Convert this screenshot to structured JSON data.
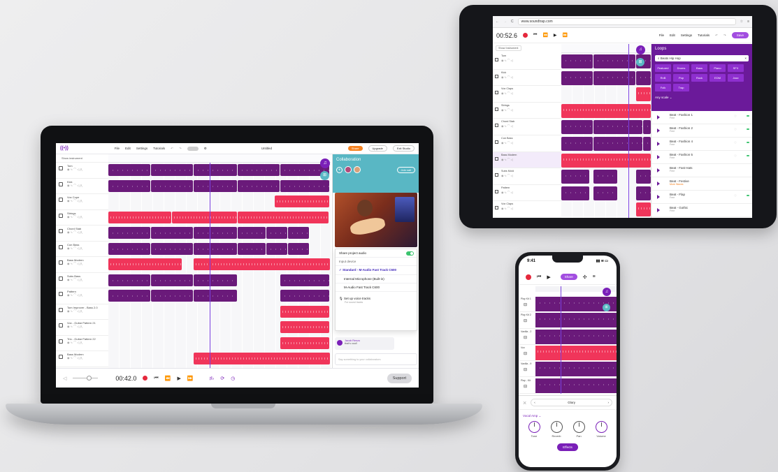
{
  "laptop": {
    "logo": "((•))",
    "menu": [
      "File",
      "Edit",
      "Settings",
      "Tutorials"
    ],
    "project_title": "Untitled",
    "buttons": {
      "share": "Share",
      "upgrade": "Upgrade",
      "exit": "Exit Studio"
    },
    "show_instrument": "Show instrument",
    "tracks": [
      "Tom",
      "Kick",
      "Vox Cope",
      "Strings",
      "Chord Stab",
      "Cun Bass",
      "Bass Modern",
      "Subs Bass",
      "Pattern",
      "Tom Improver - Bass 2.0",
      "Vox - Guitar Pattern 21",
      "Trio - Guitar Pattern 22",
      "Bass Modern"
    ],
    "collab": {
      "title": "Collaboration",
      "join": "Join call"
    },
    "share_audio": "Share project audio",
    "input_device_label": "Input device",
    "devices": [
      "Standard - M-Audio Fast Track C600",
      "Internal Microphone (Built-in)",
      "M-Audio Fast Track C600"
    ],
    "setup": {
      "title": "Set up voice tracks",
      "sub": "For sound tracks"
    },
    "chat": {
      "name": "Jacob Renzo",
      "text": "that's cool!"
    },
    "chat_placeholder": "Say something to your collaborators",
    "transport_time": "00:42.0",
    "support": "Support"
  },
  "tablet": {
    "url": "www.soundtrap.com",
    "time": "00:52.6",
    "menu": [
      "File",
      "Edit",
      "Settings",
      "Tutorials"
    ],
    "save": "Save",
    "show_instrument": "Show Instrument",
    "tracks": [
      "Tom",
      "Kick",
      "Vox Claps",
      "Strings",
      "Chord Stab",
      "Cun Bass",
      "Bass Modern",
      "Subs Mold",
      "Pattern",
      "Vox Claps"
    ],
    "loops": {
      "title": "Loops",
      "search": "Beats Hip Hop",
      "chips": [
        "Featured",
        "Drums",
        "Bass",
        "Piano",
        "SFX",
        "RnB",
        "Pop",
        "Rock",
        "EDM",
        "Jazz",
        "Folk",
        "Trap"
      ],
      "scale": "Any scale",
      "items": [
        {
          "name": "Beat - Fashion 1",
          "sub": "Free"
        },
        {
          "name": "Beat - Fashion 2",
          "sub": "Free"
        },
        {
          "name": "Beat - Fashion 4",
          "sub": "Free"
        },
        {
          "name": "Beat - Fashion 5",
          "sub": "Free"
        },
        {
          "name": "Beat - Fast Hats",
          "sub": "Free"
        },
        {
          "name": "Beat - Festive",
          "sub": "More Waves"
        },
        {
          "name": "Beat - Flap",
          "sub": "Free"
        },
        {
          "name": "Beat - Gothic",
          "sub": "Free"
        }
      ]
    }
  },
  "phone": {
    "time": "9:41",
    "share": "Share",
    "tracks": [
      "Play Kit 1",
      "Play Kit 2",
      "Vanilla - 2",
      "Vox",
      "Vanilla - 9",
      "Play - Kit"
    ],
    "instrument": "Glory",
    "amp": "Vocal Amp",
    "knobs": [
      "Tone",
      "Reverb",
      "Pan",
      "Volume"
    ],
    "effects": "Effects"
  },
  "colors": {
    "purple": "#6a1a7a",
    "red": "#f0355a",
    "teal": "#59b7c4",
    "accent": "#7a1fb8",
    "orange": "#f58220"
  }
}
